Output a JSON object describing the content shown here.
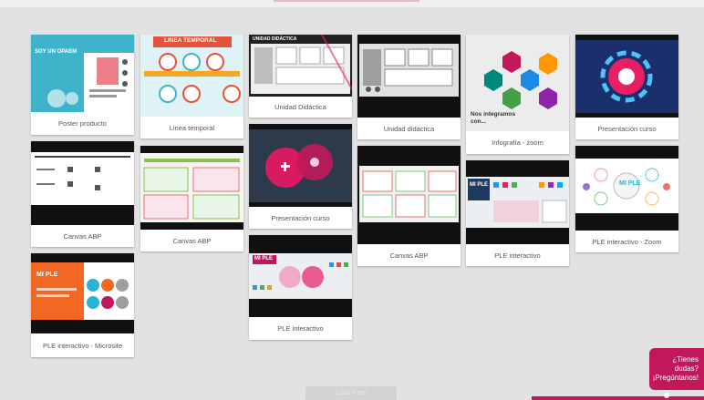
{
  "cards": [
    {
      "id": "c1",
      "title": "Poster producto"
    },
    {
      "id": "c2",
      "title": "Linea temporal"
    },
    {
      "id": "c3",
      "title": "Unidad Didáctica"
    },
    {
      "id": "c4",
      "title": "Unidad didáctica"
    },
    {
      "id": "c5",
      "title": "Infografía - zoom"
    },
    {
      "id": "c6",
      "title": "Presentación curso"
    },
    {
      "id": "c7",
      "title": "Canvas ABP"
    },
    {
      "id": "c8",
      "title": "Canvas ABP"
    },
    {
      "id": "c9",
      "title": "Presentación curso"
    },
    {
      "id": "c10",
      "title": "Canvas ABP"
    },
    {
      "id": "c11",
      "title": "PLE interactivo"
    },
    {
      "id": "c12",
      "title": "PLE interactivo - Zoom"
    },
    {
      "id": "c13",
      "title": "PLE interactivo - Microsite"
    },
    {
      "id": "c14",
      "title": "PLE interactivo"
    }
  ],
  "thumb_text": {
    "poster_heading": "SOY UN OPAEM",
    "linea_heading": "LINEA TEMPORAL",
    "unidad_heading": "UNIDAD DIDÁCTICA",
    "infografia_text": "Nos integramos con...",
    "ple_heading": "MI PLE",
    "ple_zoom_heading": "MI PLE"
  },
  "chat_cta": {
    "line1": "¿Tienes dudas?",
    "line2": "¡Pregúntanos!"
  },
  "bottom_button": "Load more"
}
